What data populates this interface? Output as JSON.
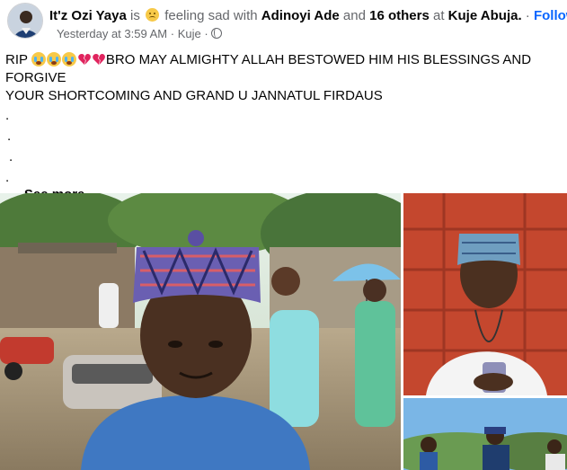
{
  "header": {
    "author": "It'z Ozi Yaya",
    "is_word": "is",
    "emoji": "sad-face-emoji",
    "feeling_text": "feeling sad with",
    "tagged_person": "Adinoyi Ade",
    "and_word": "and",
    "others": "16 others",
    "at_word": "at",
    "location": "Kuje Abuja.",
    "separator": "·",
    "follow_label": "Follow",
    "timestamp": "Yesterday at 3:59 AM",
    "place_short": "Kuje",
    "privacy_icon": "globe-icon"
  },
  "post": {
    "rip": "RIP",
    "emojis": [
      "crying-face-emoji",
      "crying-face-emoji",
      "crying-face-emoji",
      "broken-heart-emoji",
      "broken-heart-emoji"
    ],
    "line1_rest": "BRO MAY ALMIGHTY ALLAH BESTOWED HIM HIS BLESSINGS AND FORGIVE",
    "line2": "YOUR SHORTCOMING AND GRAND U JANNATUL FIRDAUS",
    "dots": [
      ".",
      ".",
      ".",
      "."
    ],
    "ellipsis": "....",
    "see_more_label": "See more"
  },
  "photos": [
    {
      "name": "main-photo"
    },
    {
      "name": "top-right-photo"
    },
    {
      "name": "bottom-right-photo"
    }
  ],
  "colors": {
    "link": "#0866ff",
    "secondary_text": "#65676b",
    "primary_text": "#050505"
  }
}
